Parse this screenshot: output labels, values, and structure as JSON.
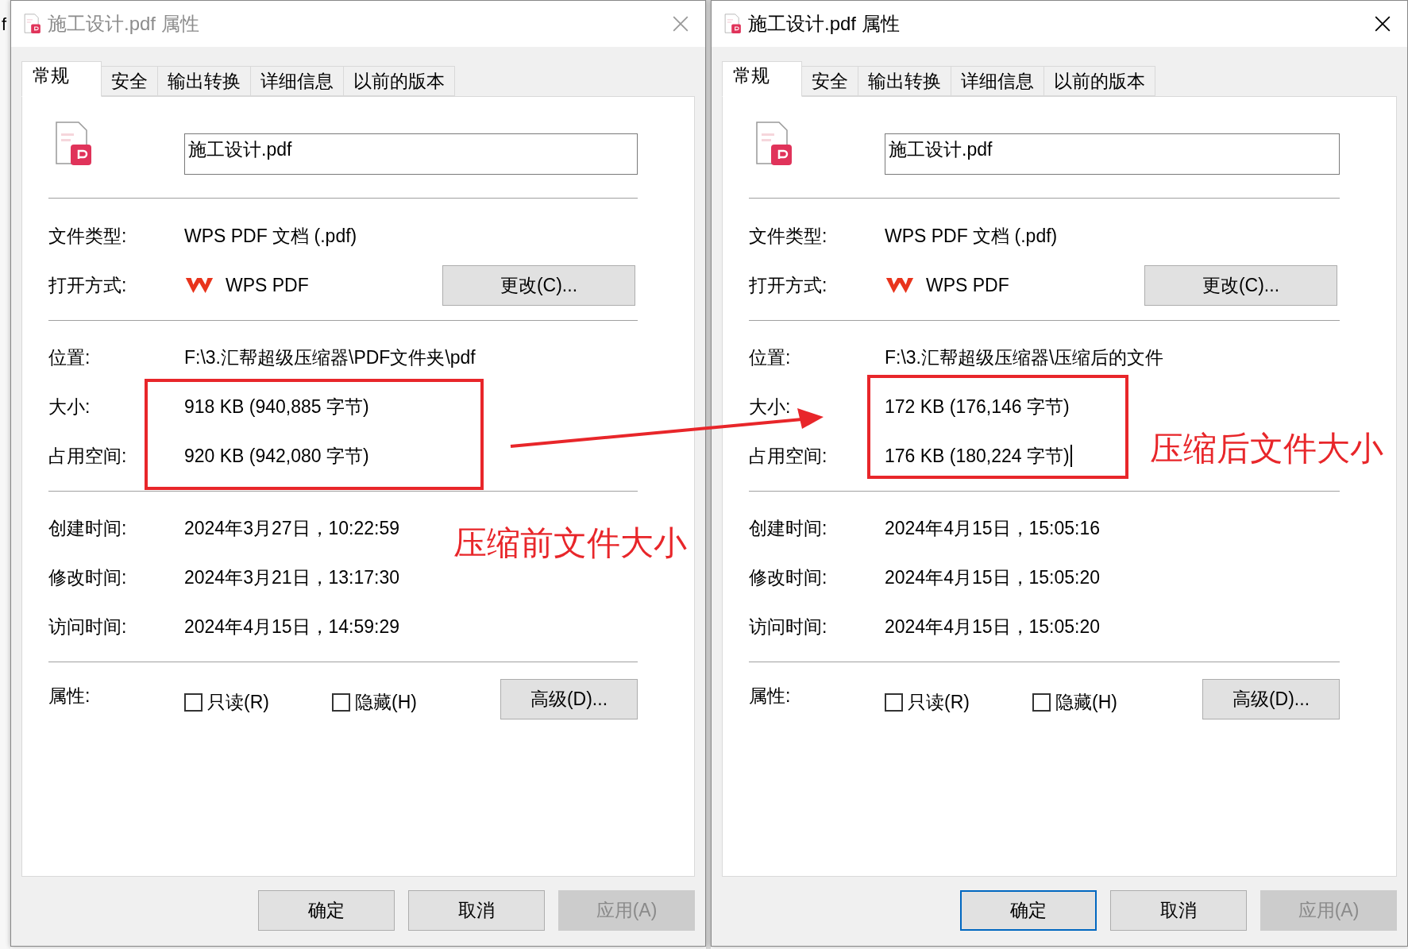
{
  "background_window": {
    "text": "f"
  },
  "dialogs": [
    {
      "title": "施工设计.pdf 属性",
      "active": false,
      "note": "压缩前文件大小",
      "tabs": [
        {
          "label": "常规",
          "selected": true
        },
        {
          "label": "安全",
          "selected": false
        },
        {
          "label": "输出转换",
          "selected": false
        },
        {
          "label": "详细信息",
          "selected": false
        },
        {
          "label": "以前的版本",
          "selected": false
        }
      ],
      "file_name": "施工设计.pdf",
      "sections": [
        {
          "rows": [
            {
              "kind": "text",
              "label": "文件类型:",
              "value": "WPS PDF 文档 (.pdf)"
            },
            {
              "kind": "app",
              "label": "打开方式:",
              "value": "WPS PDF",
              "button": "更改(C)..."
            }
          ]
        },
        {
          "rows": [
            {
              "kind": "text",
              "label": "位置:",
              "value": "F:\\3.汇帮超级压缩器\\PDF文件夹\\pdf"
            },
            {
              "kind": "text",
              "label": "大小:",
              "value": "918 KB (940,885 字节)",
              "highlighted": true
            },
            {
              "kind": "text",
              "label": "占用空间:",
              "value": "920 KB (942,080 字节)",
              "highlighted": true
            }
          ]
        },
        {
          "rows": [
            {
              "kind": "text",
              "label": "创建时间:",
              "value": "2024年3月27日，10:22:59"
            },
            {
              "kind": "text",
              "label": "修改时间:",
              "value": "2024年3月21日，13:17:30"
            },
            {
              "kind": "text",
              "label": "访问时间:",
              "value": "2024年4月15日，14:59:29"
            }
          ]
        },
        {
          "rows": [
            {
              "kind": "attributes",
              "label": "属性:",
              "checks": [
                {
                  "label": "只读(R)",
                  "checked": false
                },
                {
                  "label": "隐藏(H)",
                  "checked": false
                }
              ],
              "button": "高级(D)..."
            }
          ]
        }
      ],
      "buttons": [
        {
          "label": "确定",
          "default": false,
          "disabled": false
        },
        {
          "label": "取消",
          "default": false,
          "disabled": false
        },
        {
          "label": "应用(A)",
          "default": false,
          "disabled": true
        }
      ]
    },
    {
      "title": "施工设计.pdf 属性",
      "active": true,
      "note": "压缩后文件大小",
      "tabs": [
        {
          "label": "常规",
          "selected": true
        },
        {
          "label": "安全",
          "selected": false
        },
        {
          "label": "输出转换",
          "selected": false
        },
        {
          "label": "详细信息",
          "selected": false
        },
        {
          "label": "以前的版本",
          "selected": false
        }
      ],
      "file_name": "施工设计.pdf",
      "sections": [
        {
          "rows": [
            {
              "kind": "text",
              "label": "文件类型:",
              "value": "WPS PDF 文档 (.pdf)"
            },
            {
              "kind": "app",
              "label": "打开方式:",
              "value": "WPS PDF",
              "button": "更改(C)..."
            }
          ]
        },
        {
          "rows": [
            {
              "kind": "text",
              "label": "位置:",
              "value": "F:\\3.汇帮超级压缩器\\压缩后的文件"
            },
            {
              "kind": "text",
              "label": "大小:",
              "value": "172 KB (176,146 字节)",
              "highlighted": true
            },
            {
              "kind": "text",
              "label": "占用空间:",
              "value": "176 KB (180,224 字节)",
              "highlighted": true,
              "caret": true
            }
          ]
        },
        {
          "rows": [
            {
              "kind": "text",
              "label": "创建时间:",
              "value": "2024年4月15日，15:05:16"
            },
            {
              "kind": "text",
              "label": "修改时间:",
              "value": "2024年4月15日，15:05:20"
            },
            {
              "kind": "text",
              "label": "访问时间:",
              "value": "2024年4月15日，15:05:20"
            }
          ]
        },
        {
          "rows": [
            {
              "kind": "attributes",
              "label": "属性:",
              "checks": [
                {
                  "label": "只读(R)",
                  "checked": false
                },
                {
                  "label": "隐藏(H)",
                  "checked": false
                }
              ],
              "button": "高级(D)..."
            }
          ]
        }
      ],
      "buttons": [
        {
          "label": "确定",
          "default": true,
          "disabled": false
        },
        {
          "label": "取消",
          "default": false,
          "disabled": false
        },
        {
          "label": "应用(A)",
          "default": false,
          "disabled": true
        }
      ]
    }
  ]
}
